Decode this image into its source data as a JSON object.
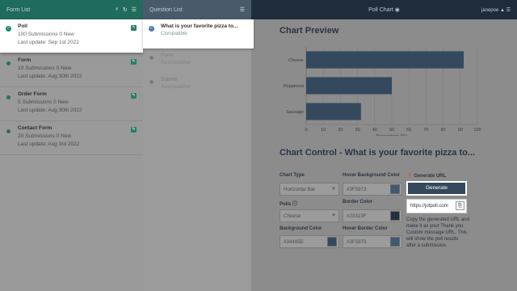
{
  "form_list": {
    "header": "Form List",
    "icons": [
      "search-icon",
      "refresh-icon",
      "menu-icon"
    ],
    "items": [
      {
        "title": "Poll",
        "submissions_count": "100",
        "submissions_label": "Submissions",
        "new_label": "0 New",
        "last_update": "Last update: Sep 1st 2022",
        "active": true
      },
      {
        "title": "Form",
        "submissions_count": "10",
        "submissions_label": "Submissions",
        "new_label": "0 New",
        "last_update": "Last update: Aug 30th 2022"
      },
      {
        "title": "Order Form",
        "submissions_count": "5",
        "submissions_label": "Submissions",
        "new_label": "0 New",
        "last_update": "Last update: Aug 30th 2022"
      },
      {
        "title": "Contact Form",
        "submissions_count": "20",
        "submissions_label": "Submissions",
        "new_label": "0 New",
        "last_update": "Last update: Aug 3rd 2022"
      }
    ]
  },
  "question_list": {
    "header": "Question List",
    "items": [
      {
        "title": "What is your favorite pizza to...",
        "status": "Compatible",
        "active": true
      },
      {
        "title": "Form",
        "status": "Incompatible"
      },
      {
        "title": "Submit",
        "status": "Incompatible"
      }
    ]
  },
  "topbar": {
    "title": "Poll Chart",
    "user": "janepoe"
  },
  "chart_preview": {
    "title": "Chart Preview"
  },
  "chart_data": {
    "type": "bar",
    "orientation": "horizontal",
    "categories": [
      "Cheese",
      "Pepperoni",
      "Sausage"
    ],
    "values": [
      92,
      50,
      32
    ],
    "xlabel": "Percentage (%)",
    "xlim": [
      0,
      100
    ],
    "ticks": [
      0,
      10,
      20,
      30,
      40,
      50,
      60,
      70,
      80,
      90,
      100
    ],
    "bar_color": "#34495E",
    "grid": true
  },
  "control": {
    "title": "Chart Control - What is your favorite pizza to...",
    "chart_type_label": "Chart Type",
    "chart_type_value": "Horizontal Bar",
    "hover_bg_label": "Hover Background Color",
    "hover_bg_value": "#3F5973",
    "polls_label": "Polls",
    "polls_value": "Cheese",
    "border_label": "Border Color",
    "border_value": "#23313F",
    "bg_label": "Background Color",
    "bg_value": "#34495E",
    "hover_border_label": "Hover Border Color",
    "hover_border_value": "#3F5973",
    "generate_url_label": "Generate URL",
    "generate_button": "Generate",
    "url_value": "https://jotpoll.com",
    "note": "Copy the generated URL and make it as your Thank you Custom message URL. This will show the poll results after a submission."
  }
}
